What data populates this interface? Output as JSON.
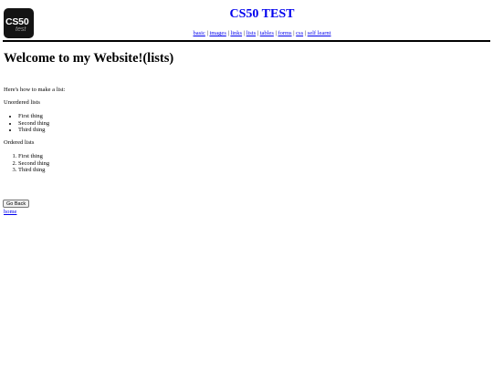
{
  "logo": {
    "text_main": "CS50",
    "text_sub": "test"
  },
  "header": {
    "title": "CS50 TEST",
    "nav": [
      {
        "label": "basic"
      },
      {
        "label": "images"
      },
      {
        "label": "links"
      },
      {
        "label": "lists"
      },
      {
        "label": "tables"
      },
      {
        "label": "forms"
      },
      {
        "label": "css"
      },
      {
        "label": "self learnt"
      }
    ]
  },
  "content": {
    "heading": "Welcome to my Website!(lists)",
    "intro": "Here's how to make a list:",
    "unordered_label": "Unordered lists",
    "unordered_items": [
      "First thing",
      "Second thing",
      "Third thing"
    ],
    "ordered_label": "Ordered lists",
    "ordered_items": [
      "First thing",
      "Second thing",
      "Third thing"
    ]
  },
  "actions": {
    "go_back_label": "Go Back",
    "home_link": "home"
  }
}
